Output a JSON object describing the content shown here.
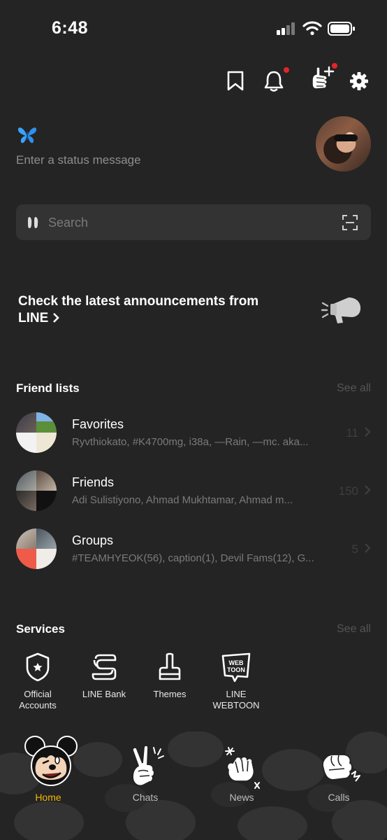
{
  "status_bar": {
    "time": "6:48"
  },
  "header": {
    "icons": [
      "bookmark-icon",
      "bell-icon",
      "add-friend-icon",
      "gear-icon"
    ],
    "badge_color": "#e4252a"
  },
  "profile": {
    "status_placeholder": "Enter a status message",
    "emoji": "butterfly-icon"
  },
  "search": {
    "placeholder": "Search"
  },
  "announcement": {
    "line1": "Check the latest announcements from",
    "line2": "LINE"
  },
  "friend_lists": {
    "title": "Friend lists",
    "see_all": "See all",
    "items": [
      {
        "title": "Favorites",
        "subtitle": "Ryvthiokato, #K4700mg, i38a, —Rain, —mc. aka...",
        "count": "11"
      },
      {
        "title": "Friends",
        "subtitle": "Adi Sulistiyono, Ahmad Mukhtamar, Ahmad m...",
        "count": "150"
      },
      {
        "title": "Groups",
        "subtitle": "#TEAMHYEOK(56), caption(1), Devil Fams(12), G...",
        "count": "5"
      }
    ]
  },
  "services": {
    "title": "Services",
    "see_all": "See all",
    "items": [
      {
        "line1": "Official",
        "line2": "Accounts",
        "icon": "shield-star-icon"
      },
      {
        "line1": "LINE Bank",
        "line2": "",
        "icon": "bank-icon"
      },
      {
        "line1": "Themes",
        "line2": "",
        "icon": "brush-icon"
      },
      {
        "line1": "LINE",
        "line2": "WEBTOON",
        "icon": "webtoon-icon"
      }
    ]
  },
  "bottom_nav": {
    "active_color": "#f5b800",
    "tabs": [
      {
        "label": "Home",
        "icon": "mickey-head-icon"
      },
      {
        "label": "Chats",
        "icon": "peace-hand-icon"
      },
      {
        "label": "News",
        "icon": "wave-hand-icon"
      },
      {
        "label": "Calls",
        "icon": "fist-icon"
      }
    ]
  }
}
